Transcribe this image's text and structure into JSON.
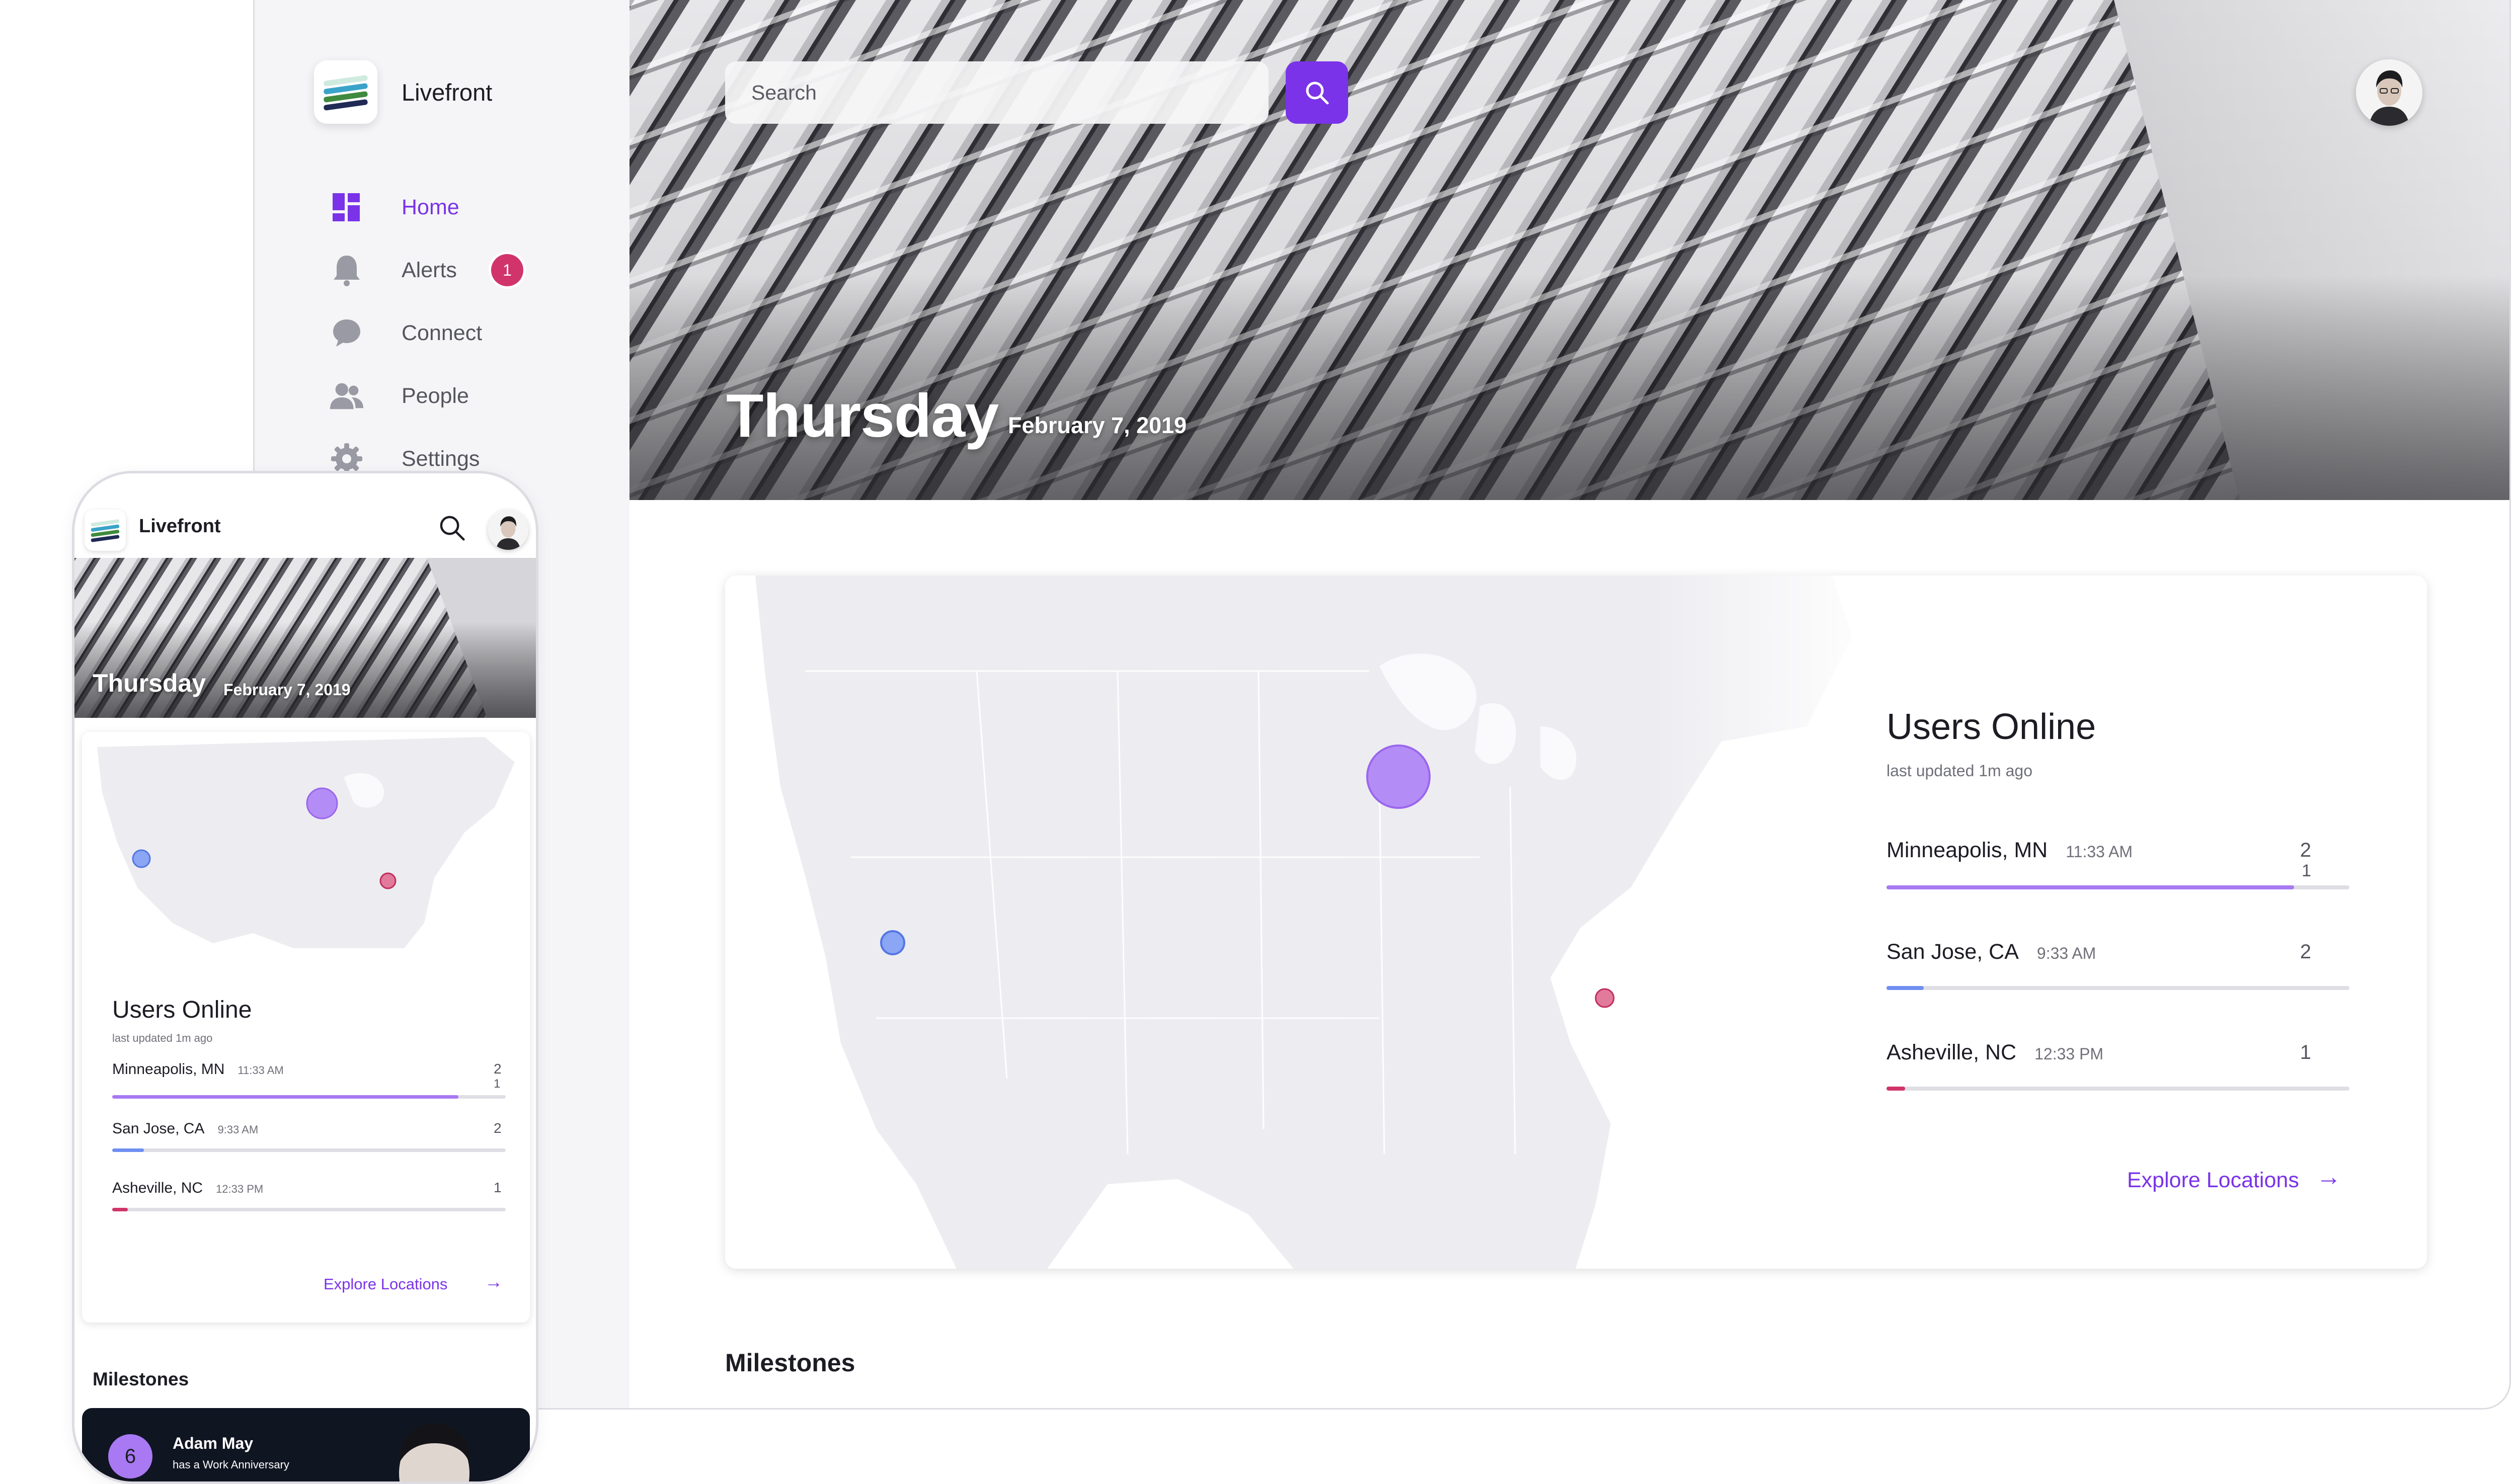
{
  "app": {
    "brand": "Livefront",
    "accent_color": "#7a33e8",
    "badge_color": "#d1346a"
  },
  "sidebar": {
    "items": [
      {
        "label": "Home",
        "icon": "dashboard-icon",
        "active": true
      },
      {
        "label": "Alerts",
        "icon": "bell-icon",
        "badge": "1"
      },
      {
        "label": "Connect",
        "icon": "chat-bubble-icon"
      },
      {
        "label": "People",
        "icon": "people-icon"
      },
      {
        "label": "Settings",
        "icon": "gear-icon"
      }
    ]
  },
  "header": {
    "search_placeholder": "Search",
    "day": "Thursday",
    "date": "February 7, 2019"
  },
  "users_online": {
    "title": "Users Online",
    "subtitle": "last updated 1m ago",
    "rows": [
      {
        "city": "Minneapolis, MN",
        "time": "11:33 AM",
        "count": "2",
        "sub_count": "1",
        "fraction": 0.88,
        "color": "#a879f2"
      },
      {
        "city": "San Jose, CA",
        "time": "9:33 AM",
        "count": "2",
        "fraction": 0.08,
        "color": "#6f8ff0"
      },
      {
        "city": "Asheville, NC",
        "time": "12:33 PM",
        "count": "1",
        "fraction": 0.04,
        "color": "#d1346a"
      }
    ],
    "explore_label": "Explore Locations"
  },
  "milestones": {
    "title": "Milestones",
    "first": {
      "number": "6",
      "name": "Adam May",
      "text": "has a Work Anniversary"
    }
  }
}
